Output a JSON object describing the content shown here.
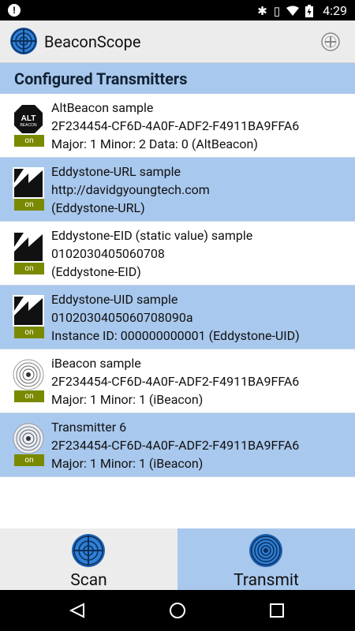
{
  "status_bar": {
    "time": "4:29",
    "icons": [
      "alert-icon",
      "bluetooth-icon",
      "vibrate-icon",
      "wifi-icon",
      "battery-charging-icon"
    ]
  },
  "app_bar": {
    "title": "BeaconScope"
  },
  "section": {
    "title": "Configured Transmitters"
  },
  "transmitters": [
    {
      "icon": "altbeacon",
      "badge": "on",
      "lines": [
        "AltBeacon sample",
        "2F234454-CF6D-4A0F-ADF2-F4911BA9FFA6",
        "Major: 1  Minor: 2  Data: 0 (AltBeacon)"
      ]
    },
    {
      "icon": "eddystone",
      "badge": "on",
      "lines": [
        "Eddystone-URL sample",
        "http://davidgyoungtech.com",
        "(Eddystone-URL)"
      ]
    },
    {
      "icon": "eddystone",
      "badge": "on",
      "lines": [
        "Eddystone-EID (static value) sample",
        "0102030405060708",
        "(Eddystone-EID)"
      ]
    },
    {
      "icon": "eddystone",
      "badge": "on",
      "lines": [
        "Eddystone-UID sample",
        "0102030405060708090a",
        "Instance ID: 000000000001 (Eddystone-UID)"
      ]
    },
    {
      "icon": "ibeacon",
      "badge": "on",
      "lines": [
        "iBeacon sample",
        "2F234454-CF6D-4A0F-ADF2-F4911BA9FFA6",
        "Major: 1  Minor: 1 (iBeacon)"
      ]
    },
    {
      "icon": "ibeacon",
      "badge": "on",
      "lines": [
        "Transmitter 6",
        "2F234454-CF6D-4A0F-ADF2-F4911BA9FFA6",
        "Major: 1  Minor: 1 (iBeacon)"
      ]
    }
  ],
  "tabs": {
    "scan": "Scan",
    "transmit": "Transmit",
    "selected": "transmit"
  },
  "colors": {
    "accent": "#a9c8ed",
    "badge": "#7a8a00"
  }
}
